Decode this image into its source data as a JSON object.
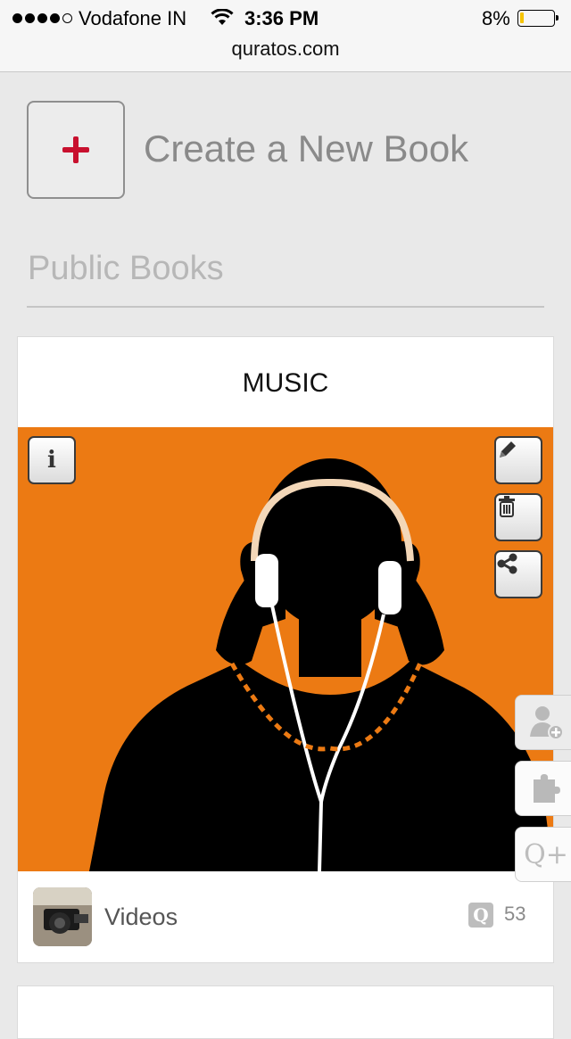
{
  "status_bar": {
    "carrier": "Vodafone IN",
    "time": "3:36 PM",
    "battery": "8%",
    "url": "quratos.com"
  },
  "create": {
    "label": "Create a New Book",
    "icon": "plus-icon",
    "accent": "#c8102e"
  },
  "section": {
    "title": "Public Books"
  },
  "book": {
    "title": "MUSIC",
    "cover_color": "#ec7a13",
    "info_glyph": "i",
    "footer_label": "Videos",
    "badge": "Q",
    "count": "53"
  },
  "side_tabs": {
    "qplus": "Q+"
  },
  "icons": [
    "wifi-icon",
    "plus-icon",
    "info-icon",
    "pencil-icon",
    "trash-icon",
    "share-icon",
    "add-user-icon",
    "puzzle-icon"
  ]
}
